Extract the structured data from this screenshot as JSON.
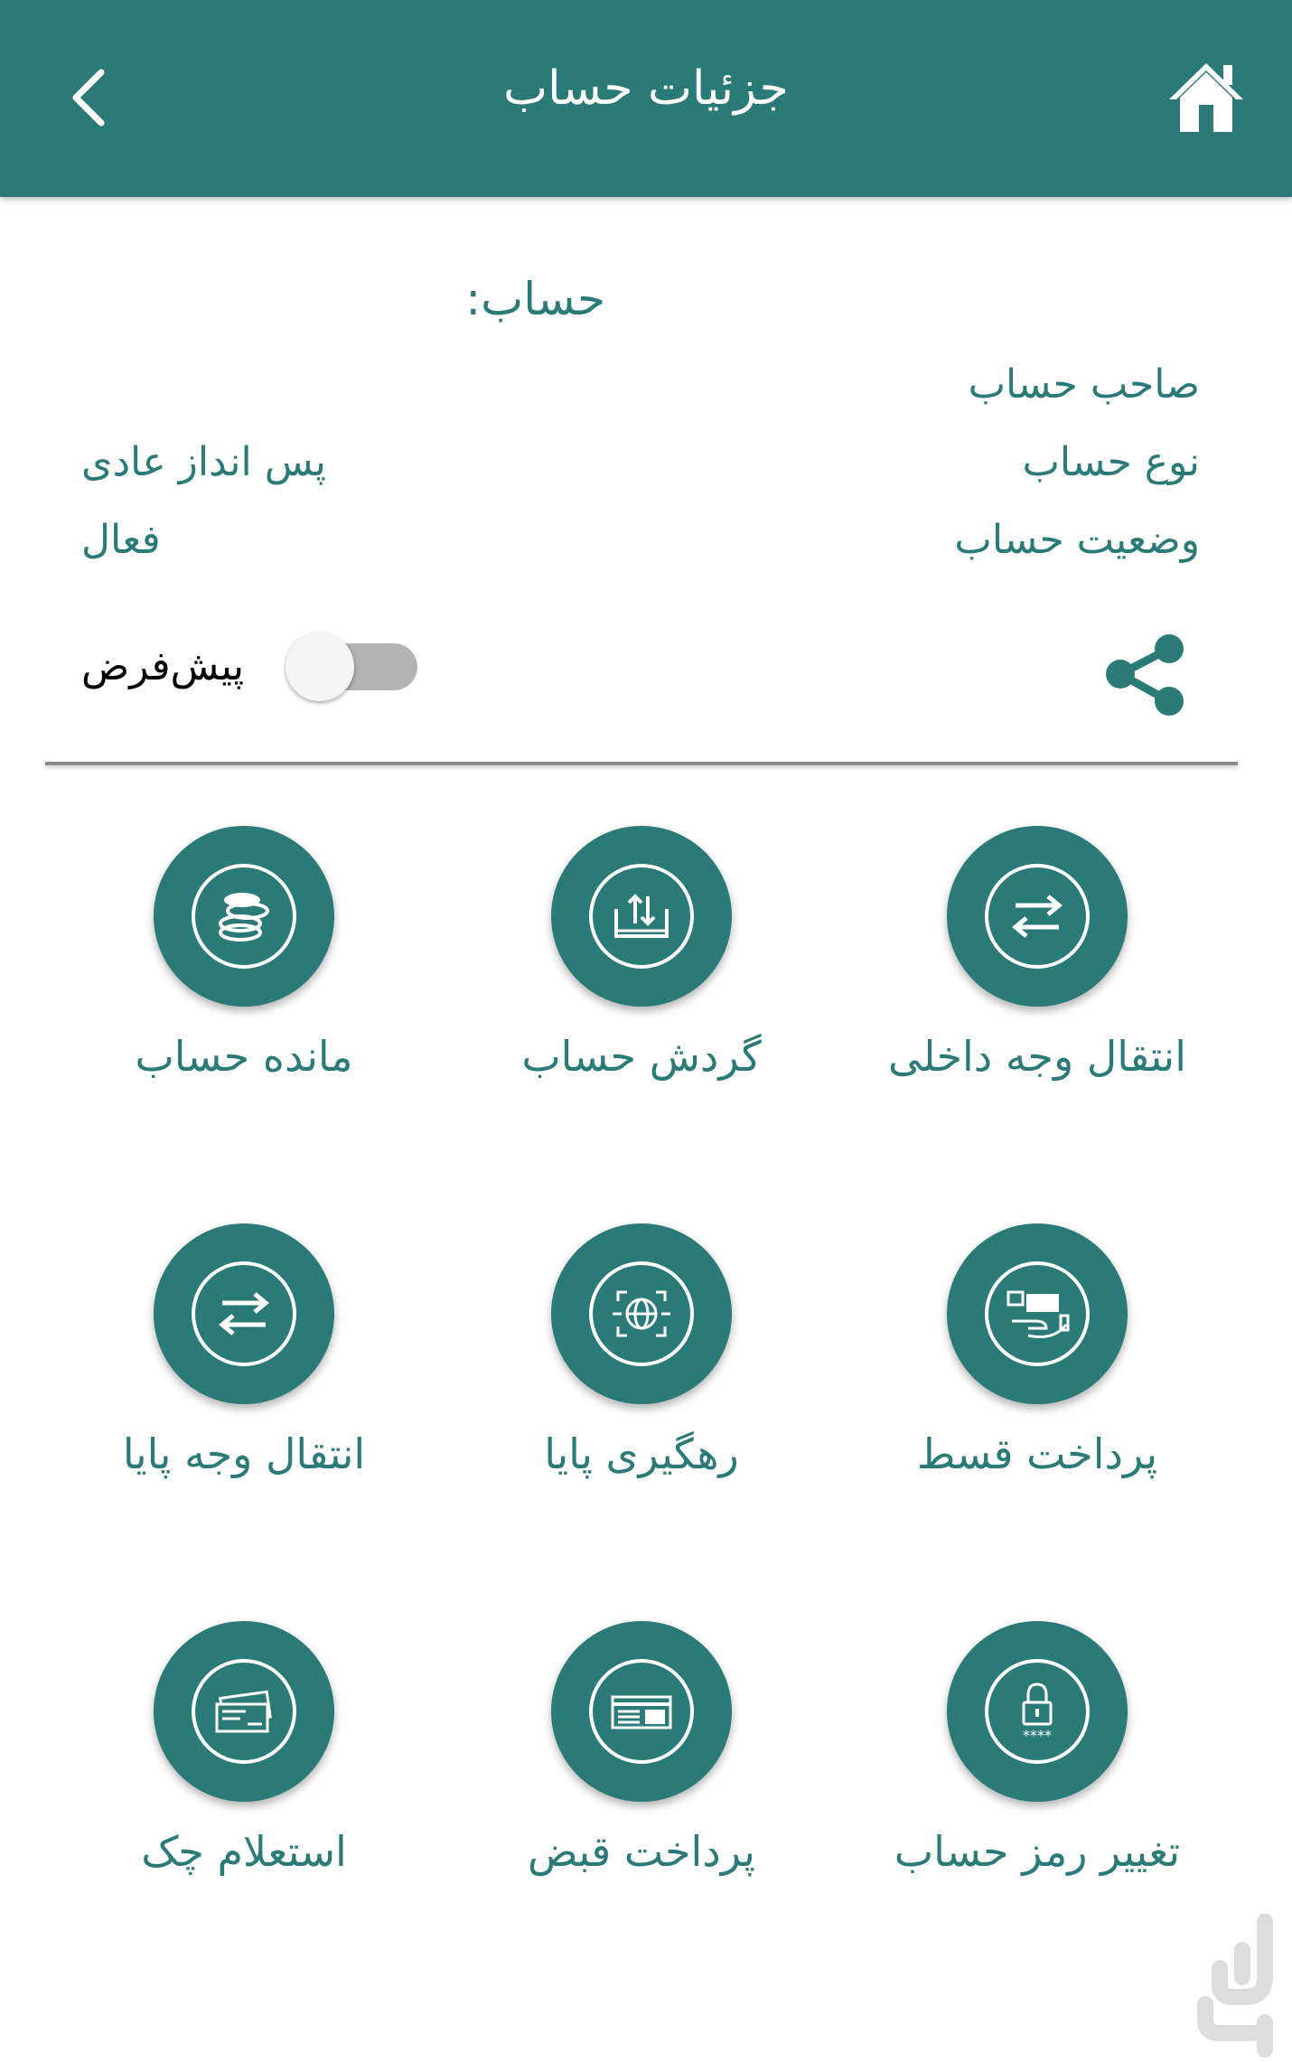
{
  "header": {
    "title": "جزئیات حساب",
    "back_icon": "chevron-left-icon",
    "home_icon": "home-icon"
  },
  "account": {
    "label": "حساب:",
    "rows": [
      {
        "label": "صاحب حساب",
        "value": ""
      },
      {
        "label": "نوع حساب",
        "value": "پس انداز عادی"
      },
      {
        "label": "وضعیت حساب",
        "value": "فعال"
      }
    ]
  },
  "default_toggle": {
    "label": "پیش‌فرض",
    "on": false
  },
  "share_icon": "share-icon",
  "services": [
    {
      "label": "انتقال وجه داخلی",
      "icon": "transfer-arrows-icon"
    },
    {
      "label": "گردش حساب",
      "icon": "upload-tray-icon"
    },
    {
      "label": "مانده حساب",
      "icon": "coins-icon"
    },
    {
      "label": "پرداخت قسط",
      "icon": "hand-payment-icon"
    },
    {
      "label": "رهگیری پایا",
      "icon": "globe-scan-icon"
    },
    {
      "label": "انتقال وجه پایا",
      "icon": "transfer-arrows-icon"
    },
    {
      "label": "تغییر رمز حساب",
      "icon": "lock-password-icon"
    },
    {
      "label": "پرداخت قبض",
      "icon": "bill-icon"
    },
    {
      "label": "استعلام چک",
      "icon": "cheque-icon"
    }
  ],
  "colors": {
    "primary": "#2a7b78",
    "toggle_track": "#b3b3b3"
  }
}
